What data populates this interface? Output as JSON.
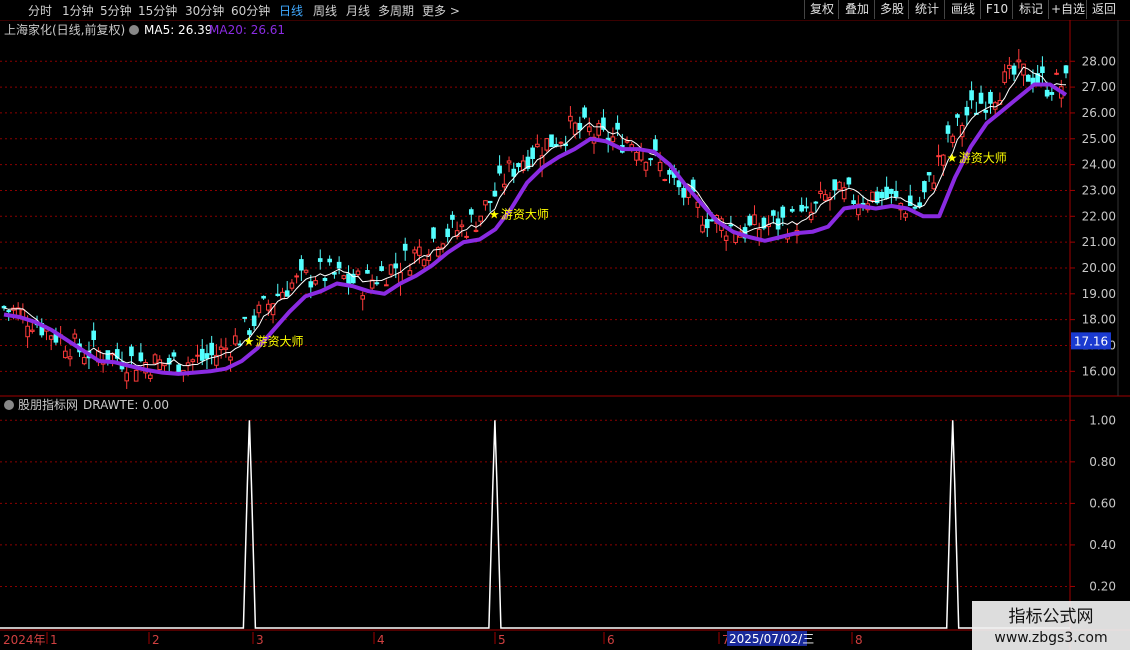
{
  "toolbar": {
    "periods": [
      "分时",
      "1分钟",
      "5分钟",
      "15分钟",
      "30分钟",
      "60分钟",
      "日线",
      "周线",
      "月线",
      "多周期",
      "更多 >"
    ],
    "active": "日线",
    "right_buttons": [
      "复权",
      "叠加",
      "多股",
      "统计",
      "画线",
      "F10",
      "标记",
      "+自选",
      "返回"
    ]
  },
  "main_header": {
    "stock": "上海家化(日线,前复权)",
    "ma5_label": "MA5: 26.39",
    "ma20_label": "MA20: 26.61"
  },
  "sub_header": {
    "name": "股朋指标网",
    "value_label": "DRAWTE: 0.00"
  },
  "price_label": "17.16",
  "signal_label": "游资大师",
  "xaxis": {
    "year": "2024年",
    "months": [
      "1",
      "2",
      "3",
      "4",
      "5",
      "6",
      "7",
      "8"
    ],
    "cursor_date": "2025/07/02/三"
  },
  "watermark": {
    "line1": "指标公式网",
    "line2": "www.zbgs3.com"
  },
  "colors": {
    "up": "#ff3b3b",
    "down": "#54ffff",
    "ma5": "#ffffff",
    "ma20": "#8a2be2",
    "signal": "#ffff00",
    "grid": "#8b0000"
  },
  "chart_data": [
    {
      "type": "candlestick",
      "title": "上海家化(日线,前复权)",
      "ylim": [
        15.2,
        28.9
      ],
      "yticks": [
        16.0,
        17.0,
        18.0,
        19.0,
        20.0,
        21.0,
        22.0,
        23.0,
        24.0,
        25.0,
        26.0,
        27.0,
        28.0
      ],
      "series": [
        {
          "name": "MA5",
          "last": 26.39
        },
        {
          "name": "MA20",
          "last": 26.61,
          "values": [
            18.2,
            18.1,
            17.9,
            17.6,
            17.2,
            16.8,
            16.4,
            16.35,
            16.2,
            16.05,
            15.95,
            15.9,
            15.95,
            16.0,
            16.1,
            16.4,
            16.9,
            17.6,
            18.3,
            18.9,
            19.1,
            19.4,
            19.3,
            19.1,
            19.0,
            19.4,
            19.7,
            20.1,
            20.6,
            21.0,
            21.1,
            21.5,
            22.3,
            23.3,
            23.9,
            24.3,
            24.6,
            25.0,
            24.9,
            24.6,
            24.6,
            24.5,
            24.0,
            23.2,
            22.5,
            21.8,
            21.4,
            21.2,
            21.05,
            21.2,
            21.35,
            21.4,
            21.6,
            22.3,
            22.4,
            22.3,
            22.4,
            22.3,
            22.0,
            22.0,
            23.5,
            24.7,
            25.6,
            26.1,
            26.6,
            27.1,
            27.1,
            26.7
          ]
        }
      ],
      "signals": [
        {
          "bar": 52,
          "price": 17.2,
          "label": "游资大师"
        },
        {
          "bar": 104,
          "price": 22.1,
          "label": "游资大师"
        },
        {
          "bar": 201,
          "price": 24.3,
          "label": "游资大师"
        }
      ],
      "last_price": 17.16
    },
    {
      "type": "line",
      "title": "股朋指标网",
      "series": [
        {
          "name": "DRAWTE",
          "last": 0.0,
          "spikes": [
            {
              "bar": 52,
              "value": 1.0
            },
            {
              "bar": 104,
              "value": 1.0
            },
            {
              "bar": 201,
              "value": 1.0
            }
          ]
        }
      ],
      "ylim": [
        0,
        1.04
      ],
      "yticks": [
        0.2,
        0.4,
        0.6,
        0.8,
        1.0
      ]
    }
  ]
}
